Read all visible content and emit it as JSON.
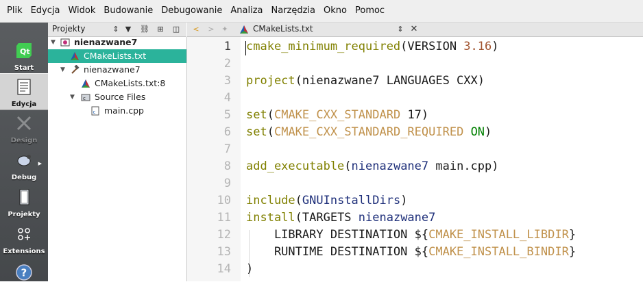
{
  "menu": [
    "Plik",
    "Edycja",
    "Widok",
    "Budowanie",
    "Debugowanie",
    "Analiza",
    "Narzędzia",
    "Okno",
    "Pomoc"
  ],
  "modes": [
    {
      "label": "Start",
      "icon": "qt-logo-icon",
      "state": "normal"
    },
    {
      "label": "Edycja",
      "icon": "document-icon",
      "state": "active"
    },
    {
      "label": "Design",
      "icon": "design-tools-icon",
      "state": "disabled"
    },
    {
      "label": "Debug",
      "icon": "bug-icon",
      "state": "normal"
    },
    {
      "label": "Projekty",
      "icon": "folder-icon",
      "state": "normal"
    },
    {
      "label": "Extensions",
      "icon": "extensions-grid-icon",
      "state": "normal"
    },
    {
      "label": "",
      "icon": "help-icon",
      "state": "normal"
    }
  ],
  "project_panel": {
    "title": "Projekty",
    "tree": [
      {
        "text": "nienazwane7",
        "icon": "cmake-project-icon",
        "bold": true,
        "expanded": true
      },
      {
        "text": "CMakeLists.txt",
        "icon": "cmake-file-icon",
        "selected": true
      },
      {
        "text": "nienazwane7",
        "icon": "build-hammer-icon",
        "expanded": true
      },
      {
        "text": "CMakeLists.txt:8",
        "icon": "cmake-file-icon"
      },
      {
        "text": "Source Files",
        "icon": "source-folder-icon",
        "expanded": true
      },
      {
        "text": "main.cpp",
        "icon": "cpp-file-icon"
      }
    ]
  },
  "editor": {
    "tab": "CMakeLists.txt",
    "current_line": 1,
    "lines": [
      {
        "n": "1",
        "tokens": [
          [
            "kw",
            "cmake_minimum_required"
          ],
          [
            "",
            "(VERSION "
          ],
          [
            "num",
            "3.16"
          ],
          [
            "",
            ")"
          ]
        ]
      },
      {
        "n": "2",
        "tokens": []
      },
      {
        "n": "3",
        "tokens": [
          [
            "kw",
            "project"
          ],
          [
            "",
            "(nienazwane7 LANGUAGES CXX)"
          ]
        ]
      },
      {
        "n": "4",
        "tokens": []
      },
      {
        "n": "5",
        "tokens": [
          [
            "kw",
            "set"
          ],
          [
            "",
            "("
          ],
          [
            "var",
            "CMAKE_CXX_STANDARD"
          ],
          [
            "",
            " 17)"
          ]
        ]
      },
      {
        "n": "6",
        "tokens": [
          [
            "kw",
            "set"
          ],
          [
            "",
            "("
          ],
          [
            "var",
            "CMAKE_CXX_STANDARD_REQUIRED"
          ],
          [
            "",
            " "
          ],
          [
            "str",
            "ON"
          ],
          [
            "",
            ")"
          ]
        ]
      },
      {
        "n": "7",
        "tokens": []
      },
      {
        "n": "8",
        "tokens": [
          [
            "kw",
            "add_executable"
          ],
          [
            "",
            "("
          ],
          [
            "tg",
            "nienazwane7"
          ],
          [
            "",
            " main.cpp)"
          ]
        ]
      },
      {
        "n": "9",
        "tokens": []
      },
      {
        "n": "10",
        "tokens": [
          [
            "kw",
            "include"
          ],
          [
            "",
            "("
          ],
          [
            "tg",
            "GNUInstallDirs"
          ],
          [
            "",
            ")"
          ]
        ]
      },
      {
        "n": "11",
        "tokens": [
          [
            "kw",
            "install"
          ],
          [
            "",
            "(TARGETS "
          ],
          [
            "tg",
            "nienazwane7"
          ]
        ]
      },
      {
        "n": "12",
        "tokens": [
          [
            "",
            "    LIBRARY DESTINATION ${"
          ],
          [
            "var",
            "CMAKE_INSTALL_LIBDIR"
          ],
          [
            "",
            "}"
          ]
        ]
      },
      {
        "n": "13",
        "tokens": [
          [
            "",
            "    RUNTIME DESTINATION ${"
          ],
          [
            "var",
            "CMAKE_INSTALL_BINDIR"
          ],
          [
            "",
            "}"
          ]
        ]
      },
      {
        "n": "14",
        "tokens": [
          [
            "",
            ")"
          ]
        ]
      }
    ]
  },
  "colors": {
    "accent": "#2bb39b",
    "keyword": "#808000",
    "variable": "#c0914b",
    "target": "#1e2f7a"
  }
}
